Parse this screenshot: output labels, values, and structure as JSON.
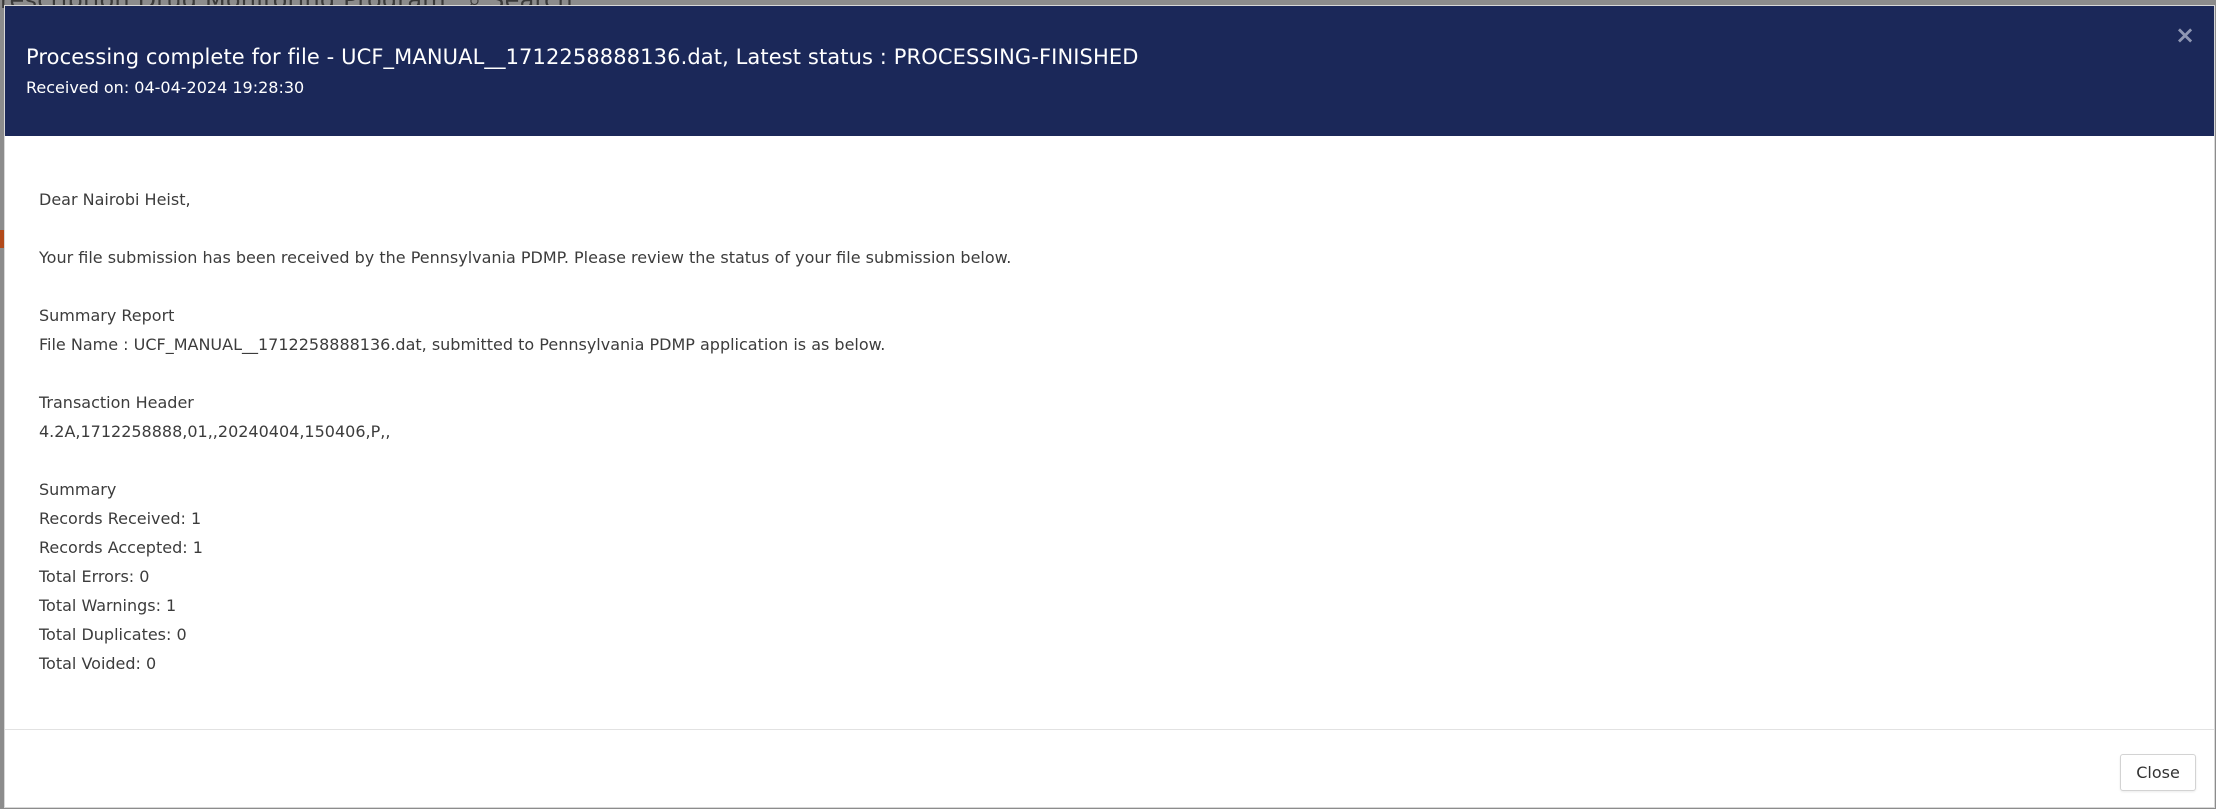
{
  "background": {
    "page_title_fragment": "rescription Drug Monitoring Program",
    "search_label": "Search"
  },
  "modal": {
    "header_color": "#1b2859",
    "title": "Processing complete for file - UCF_MANUAL__1712258888136.dat, Latest status : PROCESSING-FINISHED",
    "subtitle": "Received on: 04-04-2024 19:28:30",
    "close_x": "×",
    "body": {
      "greeting": "Dear Nairobi Heist,",
      "intro": "Your file submission has been received by the Pennsylvania PDMP. Please review the status of your file submission below.",
      "summary_report_heading": "Summary Report",
      "file_name_line": "File Name : UCF_MANUAL__1712258888136.dat, submitted to Pennsylvania PDMP application is as below.",
      "transaction_header_heading": "Transaction Header",
      "transaction_header_value": "4.2A,1712258888,01,,20240404,150406,P,,",
      "summary_heading": "Summary",
      "records_received": "Records Received: 1",
      "records_accepted": "Records Accepted: 1",
      "total_errors": "Total Errors: 0",
      "total_warnings": "Total Warnings: 1",
      "total_duplicates": "Total Duplicates: 0",
      "total_voided": "Total Voided: 0"
    },
    "footer": {
      "close_label": "Close"
    }
  }
}
